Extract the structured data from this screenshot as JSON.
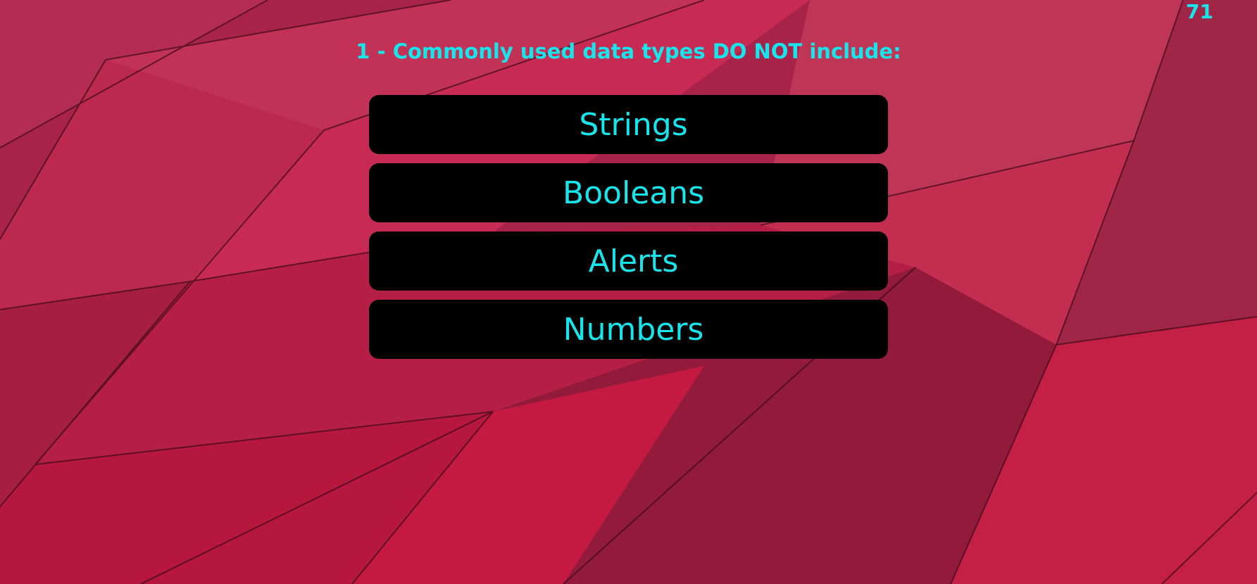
{
  "timer": "71",
  "question": "1 - Commonly used data types DO NOT include:",
  "answers": [
    {
      "label": "Strings"
    },
    {
      "label": "Booleans"
    },
    {
      "label": "Alerts"
    },
    {
      "label": "Numbers"
    }
  ],
  "colors": {
    "text_accent": "#16e6ec",
    "button_bg": "#000000",
    "background": "#b51c45"
  }
}
